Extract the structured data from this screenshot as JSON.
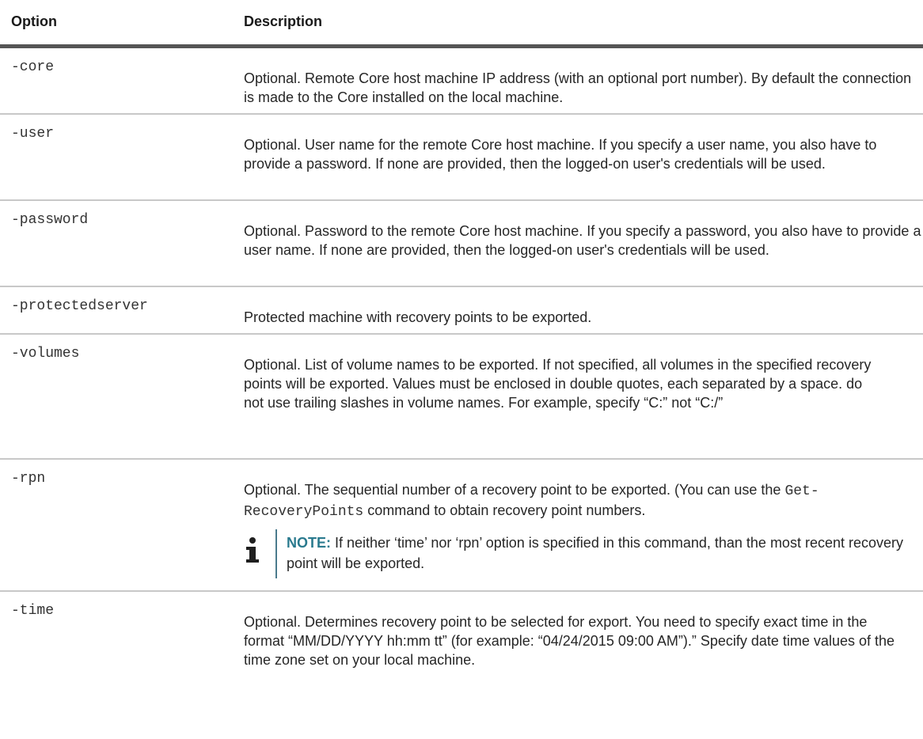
{
  "header": {
    "option": "Option",
    "description": "Description"
  },
  "rows": [
    {
      "option": "-core",
      "description": "Optional. Remote Core host machine IP address (with an optional port number). By default the connection is made to the Core installed on the local machine."
    },
    {
      "option": "-user",
      "description": "Optional. User name for the remote Core host machine. If you specify a user name, you also have to provide a password. If none are provided, then the logged-on user's credentials will be used."
    },
    {
      "option": "-password",
      "description": "Optional. Password to the remote Core host machine. If you specify a password, you also have to provide a user name. If none are provided, then the logged-on user's credentials will be used."
    },
    {
      "option": "-protectedserver",
      "description": "Protected machine with recovery points to be exported."
    },
    {
      "option": "-volumes",
      "description": "Optional. List of volume names to be exported. If not specified, all volumes in the specified recovery points will be exported. Values must be enclosed in double quotes, each separated by a space. do not use trailing slashes in volume names. For example, specify “C:” not “C:/”"
    },
    {
      "option": "-rpn",
      "description_before": "Optional. The sequential number of a recovery point to be exported. (You can use the ",
      "command": "Get-RecoveryPoints",
      "description_after": " command to obtain recovery point numbers.",
      "note_label": "NOTE:",
      "note_text": " If neither ‘time’ nor ‘rpn’ option is specified in this command, than the most recent recovery point will be exported.",
      "note_icon": "info-icon",
      "accent_color": "#2a7a8e"
    },
    {
      "option": "-time",
      "description": "Optional. Determines recovery point to be selected for export. You need to specify exact time in the format “MM/DD/YYYY hh:mm tt” (for example: “04/24/2015 09:00 AM”).” Specify date time values of the time zone set on your local machine."
    }
  ]
}
